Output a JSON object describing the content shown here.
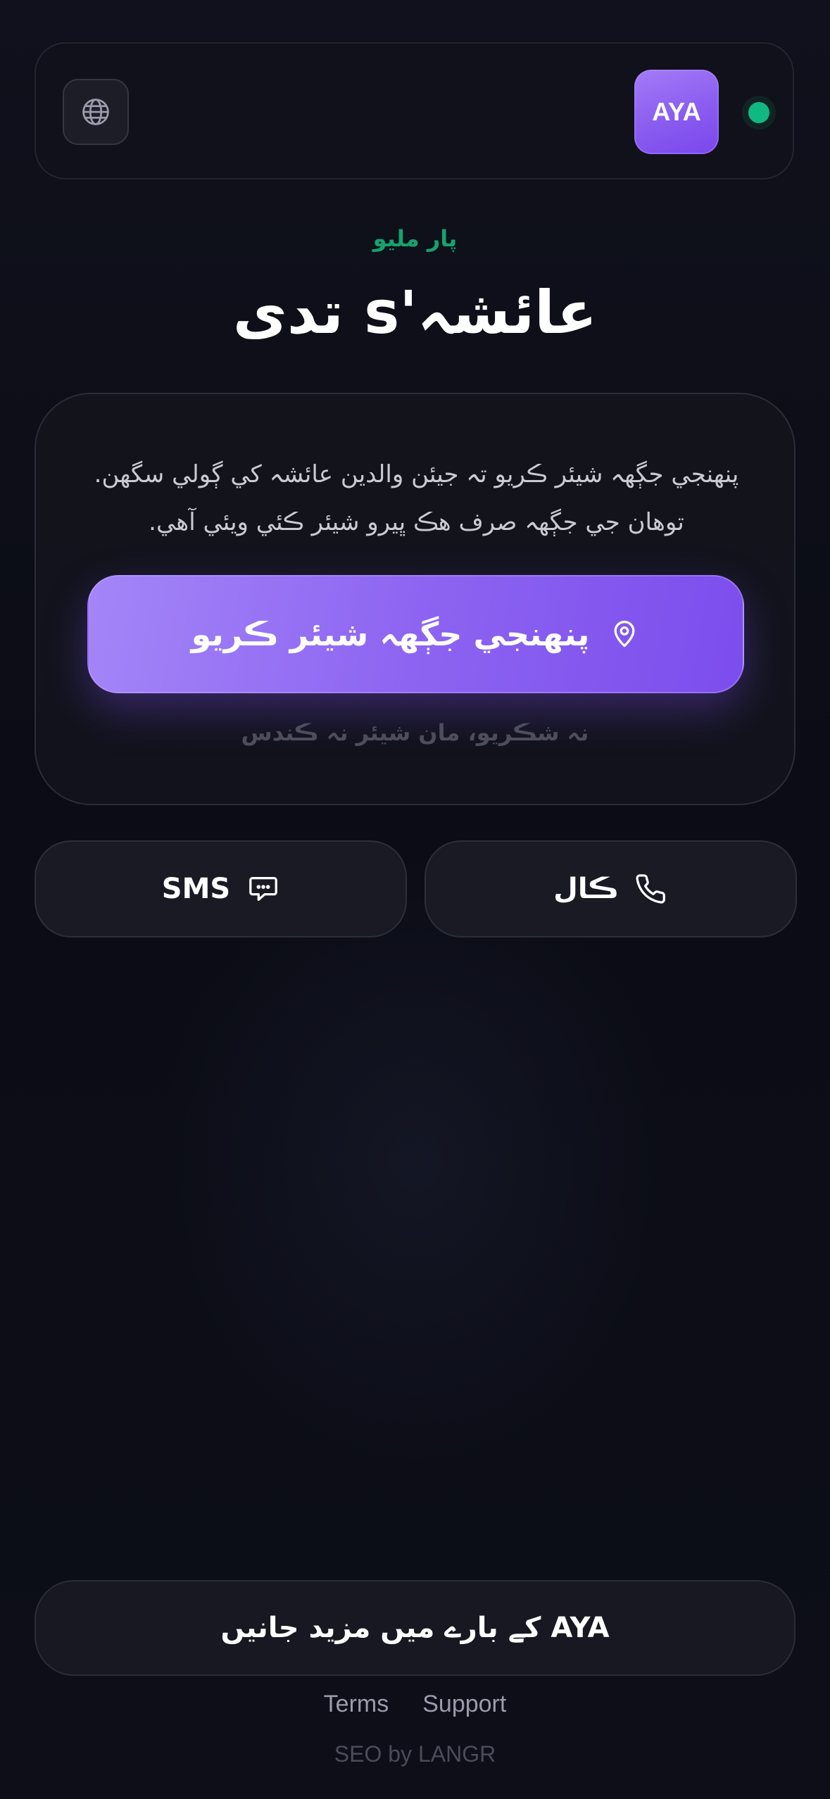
{
  "header": {
    "logo_text": "AYA",
    "globe_icon": "globe-icon",
    "status_color": "#10b981"
  },
  "hero": {
    "subtitle": "پار مليو",
    "title": "عائشہ's تدی"
  },
  "card": {
    "description": "پنهنجي جڳهہ شيئر ڪريو تہ جيئن والدين عائشہ کي ڳولي سگهن. توهان جي جڳهہ صرف هڪ ڀيرو شيئر ڪئي ويئي آهي.",
    "share_button_label": "پنهنجي جڳهہ شيئر ڪريو",
    "share_icon": "map-pin-icon",
    "decline_label": "نہ شڪريو، مان شيئر نہ ڪندس"
  },
  "actions": {
    "sms_label": "SMS",
    "sms_icon": "message-icon",
    "call_label": "ڪال",
    "call_icon": "phone-icon"
  },
  "footer": {
    "learn_more_label": "AYA کے بارے میں مزید جانیں",
    "terms_label": "Terms",
    "support_label": "Support",
    "seo_credit": "SEO by LANGR"
  },
  "colors": {
    "accent": "#8b5cf6",
    "success": "#10b981",
    "background": "#0c0c15"
  }
}
